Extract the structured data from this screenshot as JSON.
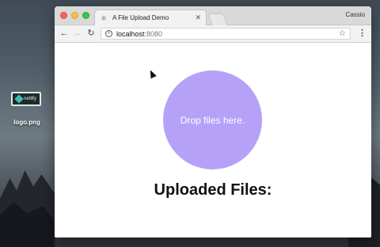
{
  "desktop": {
    "file_icon_text": "netlify",
    "file_label": "logo.png"
  },
  "browser": {
    "tab": {
      "title": "A File Upload Demo",
      "favicon": "react-atom-icon"
    },
    "profile_name": "Cassio",
    "address": {
      "host": "localhost",
      "port": ":8080"
    }
  },
  "page": {
    "dropzone_text": "Drop files here.",
    "uploaded_heading": "Uploaded Files:"
  },
  "colors": {
    "dropzone": "#b5a2f8",
    "traffic_red": "#fc605c",
    "traffic_yellow": "#fdbc40",
    "traffic_green": "#34c84a"
  }
}
